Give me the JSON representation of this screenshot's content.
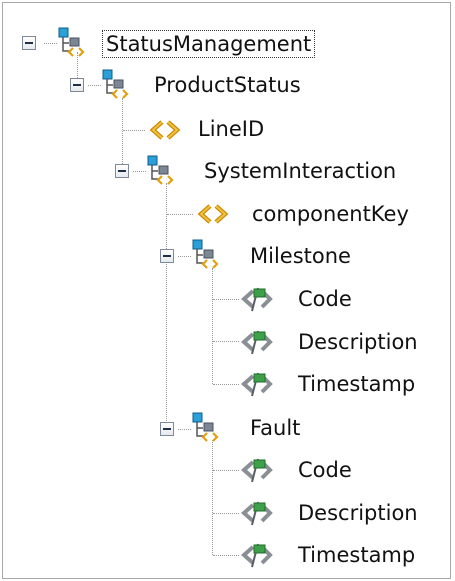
{
  "tree": {
    "root": {
      "label": "StatusManagement",
      "icon": "complex-type-icon",
      "expanded": true,
      "selected": true,
      "children": {
        "product_status": {
          "label": "ProductStatus",
          "icon": "complex-type-icon",
          "expanded": true,
          "children": {
            "line_id": {
              "label": "LineID",
              "icon": "attribute-icon"
            },
            "system_interaction": {
              "label": "SystemInteraction",
              "icon": "complex-type-icon",
              "expanded": true,
              "children": {
                "component_key": {
                  "label": "componentKey",
                  "icon": "attribute-icon"
                },
                "milestone": {
                  "label": "Milestone",
                  "icon": "complex-type-icon",
                  "expanded": true,
                  "children": {
                    "code": {
                      "label": "Code",
                      "icon": "element-icon"
                    },
                    "description": {
                      "label": "Description",
                      "icon": "element-icon"
                    },
                    "timestamp": {
                      "label": "Timestamp",
                      "icon": "element-icon"
                    }
                  }
                },
                "fault": {
                  "label": "Fault",
                  "icon": "complex-type-icon",
                  "expanded": true,
                  "children": {
                    "code": {
                      "label": "Code",
                      "icon": "element-icon"
                    },
                    "description": {
                      "label": "Description",
                      "icon": "element-icon"
                    },
                    "timestamp": {
                      "label": "Timestamp",
                      "icon": "element-icon"
                    }
                  }
                }
              }
            }
          }
        }
      }
    }
  },
  "colors": {
    "complex_blue": "#2a9fd8",
    "complex_gray": "#7b8794",
    "attribute_orange": "#e0a010",
    "element_green": "#3fa04a",
    "element_gray": "#8a8f96",
    "connector": "#9a9a9a"
  }
}
